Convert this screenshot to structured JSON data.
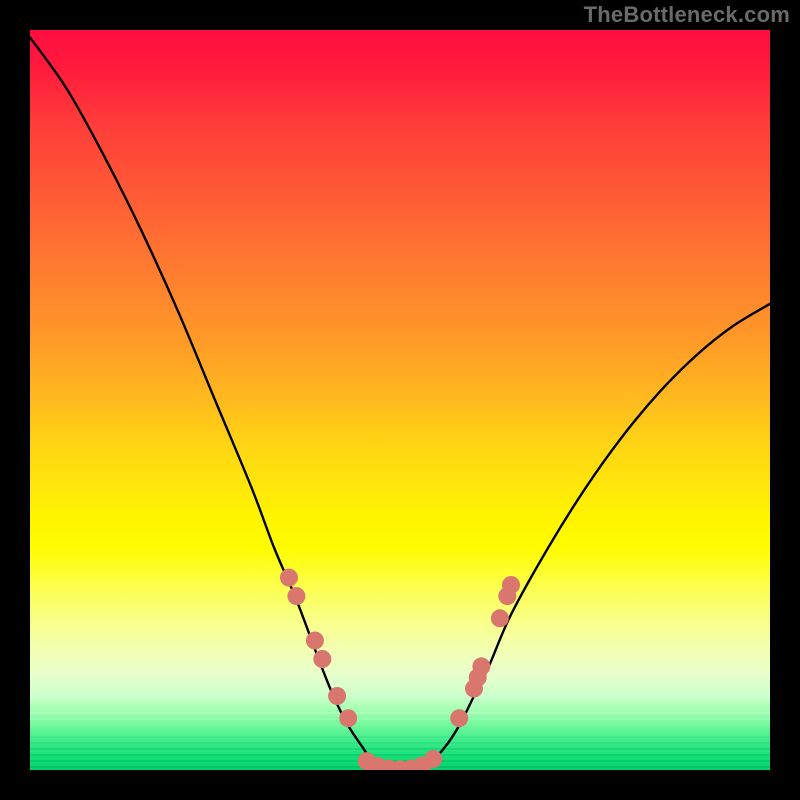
{
  "watermark": "TheBottleneck.com",
  "chart_data": {
    "type": "line",
    "title": "",
    "xlabel": "",
    "ylabel": "",
    "xlim": [
      0,
      100
    ],
    "ylim": [
      0,
      100
    ],
    "legend": false,
    "grid": false,
    "background": "rainbow-vertical-gradient",
    "series": [
      {
        "name": "bottleneck-curve",
        "color": "#000000",
        "x": [
          0,
          5,
          10,
          15,
          20,
          25,
          30,
          33,
          36,
          39,
          41,
          43,
          45,
          46,
          47,
          48,
          50,
          52,
          54,
          56,
          58,
          60,
          62,
          65,
          70,
          75,
          80,
          85,
          90,
          95,
          100
        ],
        "y": [
          99,
          92,
          83,
          73,
          62,
          50,
          38,
          30,
          23,
          15,
          10,
          6,
          3,
          1.5,
          0.7,
          0.3,
          0,
          0.3,
          1,
          3,
          6,
          10,
          14,
          21,
          30,
          38,
          45,
          51,
          56,
          60,
          63
        ]
      }
    ],
    "markers": [
      {
        "name": "left-cluster",
        "color": "#d9766e",
        "points": [
          {
            "x": 35.0,
            "y": 26.0
          },
          {
            "x": 36.0,
            "y": 23.5
          },
          {
            "x": 38.5,
            "y": 17.5
          },
          {
            "x": 39.5,
            "y": 15.0
          },
          {
            "x": 41.5,
            "y": 10.0
          },
          {
            "x": 43.0,
            "y": 7.0
          }
        ]
      },
      {
        "name": "bottom-cluster",
        "color": "#d9766e",
        "points": [
          {
            "x": 45.5,
            "y": 1.2
          },
          {
            "x": 47.0,
            "y": 0.5
          },
          {
            "x": 48.5,
            "y": 0.2
          },
          {
            "x": 50.0,
            "y": 0.1
          },
          {
            "x": 51.5,
            "y": 0.2
          },
          {
            "x": 53.0,
            "y": 0.6
          },
          {
            "x": 54.5,
            "y": 1.5
          }
        ]
      },
      {
        "name": "right-cluster",
        "color": "#d9766e",
        "points": [
          {
            "x": 58.0,
            "y": 7.0
          },
          {
            "x": 60.0,
            "y": 11.0
          },
          {
            "x": 60.5,
            "y": 12.5
          },
          {
            "x": 61.0,
            "y": 14.0
          },
          {
            "x": 63.5,
            "y": 20.5
          },
          {
            "x": 64.5,
            "y": 23.5
          },
          {
            "x": 65.0,
            "y": 25.0
          }
        ]
      }
    ]
  }
}
